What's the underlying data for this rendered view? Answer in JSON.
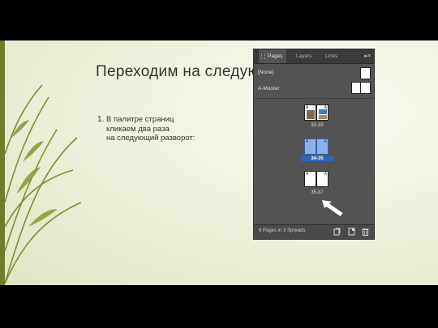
{
  "slide": {
    "title": "Переходим на следующую полосу",
    "list": [
      {
        "number": "1.",
        "text": "В палитре страниц\nкликаем два раза\nна следующий разворот:"
      }
    ]
  },
  "panel": {
    "tabs": [
      {
        "label": "Pages",
        "active": true
      },
      {
        "label": "Layers",
        "active": false
      },
      {
        "label": "Links",
        "active": false
      }
    ],
    "menu_icon": "panel-menu-icon",
    "masters": [
      {
        "label": "[None]"
      },
      {
        "label": "A-Master"
      }
    ],
    "spreads": [
      {
        "label": "33-33",
        "selected": false,
        "has_images": true
      },
      {
        "label": "34-35",
        "selected": true,
        "has_images": false
      },
      {
        "label": "35-37",
        "selected": false,
        "has_images": false
      }
    ],
    "page_marker": "A",
    "footer": {
      "status": "6 Pages in 3 Spreads",
      "icons": [
        "page-size-icon",
        "new-page-icon",
        "trash-icon"
      ]
    }
  },
  "colors": {
    "panel_bg": "#535353",
    "selection": "#2f65c2",
    "slide_accent": "#6e7f2c"
  }
}
